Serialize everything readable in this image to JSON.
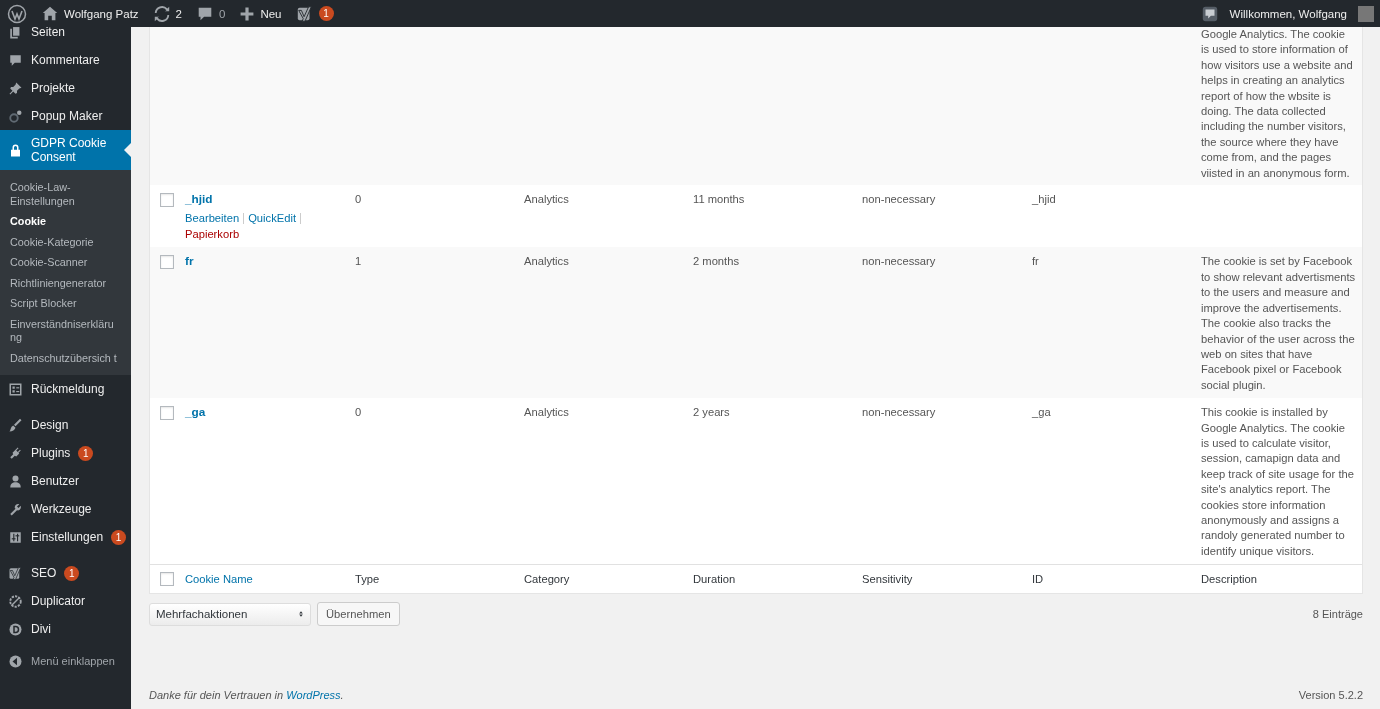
{
  "admin_bar": {
    "site_name": "Wolfgang Patz",
    "updates_count": "2",
    "comments_count": "0",
    "new_label": "Neu",
    "seo_badge": "1",
    "greeting": "Willkommen, Wolfgang"
  },
  "sidebar": {
    "groups": [
      [
        {
          "label": "Seiten",
          "selected": false
        },
        {
          "label": "Kommentare",
          "selected": false
        },
        {
          "label": "Projekte",
          "selected": false
        },
        {
          "label": "Popup Maker",
          "selected": false
        },
        {
          "label": "GDPR Cookie Consent",
          "selected": true,
          "submenu": [
            {
              "label": "Cookie-Law-Einstellungen",
              "selected": false
            },
            {
              "label": "Cookie",
              "selected": true
            },
            {
              "label": "Cookie-Kategorie",
              "selected": false
            },
            {
              "label": "Cookie-Scanner",
              "selected": false
            },
            {
              "label": "Richtliniengenerator",
              "selected": false
            },
            {
              "label": "Script Blocker",
              "selected": false
            },
            {
              "label": "Einverständniserkläru ng",
              "selected": false
            },
            {
              "label": "Datenschutzübersich t",
              "selected": false
            }
          ]
        },
        {
          "label": "Rückmeldung",
          "selected": false
        }
      ],
      [
        {
          "label": "Design",
          "selected": false
        },
        {
          "label": "Plugins",
          "selected": false,
          "badge": "1"
        },
        {
          "label": "Benutzer",
          "selected": false
        },
        {
          "label": "Werkzeuge",
          "selected": false
        },
        {
          "label": "Einstellungen",
          "selected": false,
          "badge": "1"
        }
      ],
      [
        {
          "label": "SEO",
          "selected": false,
          "badge": "1"
        },
        {
          "label": "Duplicator",
          "selected": false
        },
        {
          "label": "Divi",
          "selected": false
        }
      ]
    ],
    "collapse_label": "Menü einklappen"
  },
  "table": {
    "rows": [
      {
        "description": "Google Analytics. The cookie is used to store information of how visitors use a website and helps in creating an analytics report of how the wbsite is doing. The data collected including the number visitors, the source where they have come from, and the pages viisted in an anonymous form."
      },
      {
        "checked": false,
        "name": "_hjid",
        "actions": [
          {
            "label": "Bearbeiten",
            "kind": "edit"
          },
          {
            "label": "QuickEdit",
            "kind": "edit"
          },
          {
            "label": "Papierkorb",
            "kind": "trash"
          }
        ],
        "type": "0",
        "category": "Analytics",
        "duration": "11 months",
        "sensitivity": "non-necessary",
        "id": "_hjid"
      },
      {
        "checked": false,
        "name": "fr",
        "type": "1",
        "category": "Analytics",
        "duration": "2 months",
        "sensitivity": "non-necessary",
        "id": "fr",
        "description": "The cookie is set by Facebook to show relevant advertisments to the users and measure and improve the advertisements. The cookie also tracks the behavior of the user across the web on sites that have Facebook pixel or Facebook social plugin."
      },
      {
        "checked": false,
        "name": "_ga",
        "type": "0",
        "category": "Analytics",
        "duration": "2 years",
        "sensitivity": "non-necessary",
        "id": "_ga",
        "description": "This cookie is installed by Google Analytics. The cookie is used to calculate visitor, session, camapign data and keep track of site usage for the site's analytics report. The cookies store information anonymously and assigns a randoly generated number to identify unique visitors."
      }
    ],
    "footer_checked": false,
    "columns": [
      {
        "label": "Cookie Name",
        "sortable": true
      },
      {
        "label": "Type",
        "sortable": false
      },
      {
        "label": "Category",
        "sortable": false
      },
      {
        "label": "Duration",
        "sortable": false
      },
      {
        "label": "Sensitivity",
        "sortable": false
      },
      {
        "label": "ID",
        "sortable": false
      },
      {
        "label": "Description",
        "sortable": false
      }
    ]
  },
  "bulk_actions": {
    "select": "Mehrfachaktionen",
    "button": "Übernehmen"
  },
  "item_count": "8 Einträge",
  "footer": {
    "thanks": "Danke für dein Vertrauen in ",
    "link": "WordPress",
    "after": ".",
    "version": "Version 5.2.2"
  }
}
